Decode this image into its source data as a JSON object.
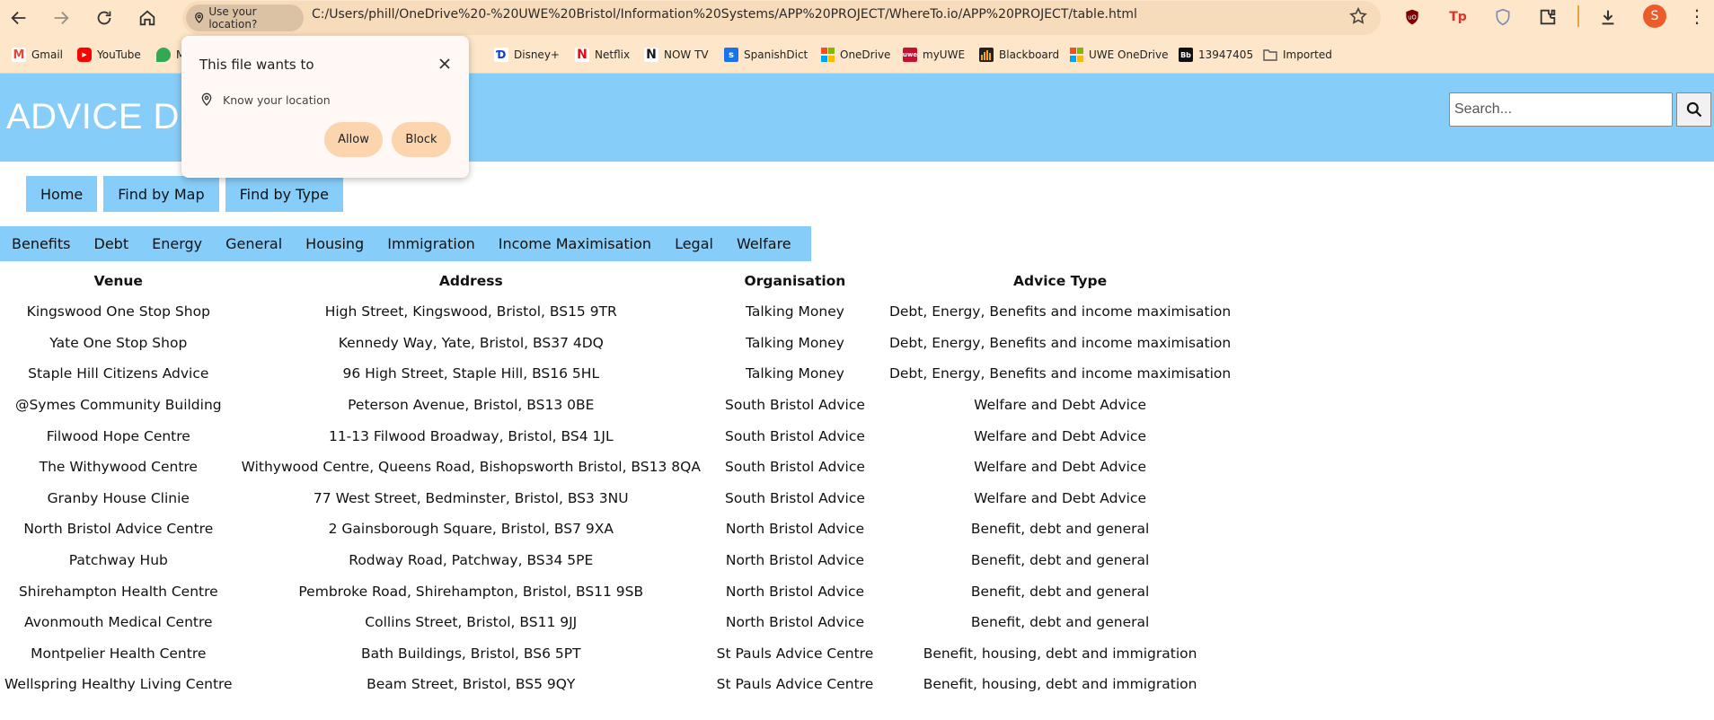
{
  "browser": {
    "location_chip": "Use your location?",
    "url": "C:/Users/phill/OneDrive%20-%20UWE%20Bristol/Information%20Systems/APP%20PROJECT/WhereTo.io/APP%20PROJECT/table.html",
    "profile_initial": "S",
    "extensions": [
      "uBlock Origin",
      "Tp",
      "shield",
      "puzzle"
    ],
    "bookmarks": [
      {
        "label": "Gmail",
        "icon": "gmail-icon",
        "color": "#ea4335"
      },
      {
        "label": "YouTube",
        "icon": "youtube-icon",
        "color": "#ff0000"
      },
      {
        "label": "M",
        "icon": "maps-icon",
        "color": "#34a853"
      },
      {
        "label": "Disney+",
        "icon": "disney-icon",
        "color": "#113ccf"
      },
      {
        "label": "Netflix",
        "icon": "netflix-icon",
        "color": "#e50914"
      },
      {
        "label": "NOW TV",
        "icon": "nowtv-icon",
        "color": "#1a1a1a"
      },
      {
        "label": "SpanishDict",
        "icon": "spanishdict-icon",
        "color": "#1a73e8"
      },
      {
        "label": "OneDrive",
        "icon": "microsoft-icon",
        "color": "#f25022"
      },
      {
        "label": "myUWE",
        "icon": "myuwe-icon",
        "color": "#c8102e"
      },
      {
        "label": "Blackboard",
        "icon": "blackboard-icon",
        "color": "#222222"
      },
      {
        "label": "UWE OneDrive",
        "icon": "microsoft-icon",
        "color": "#f25022"
      },
      {
        "label": "13947405",
        "icon": "bb-icon",
        "color": "#111111"
      },
      {
        "label": "Imported",
        "icon": "folder-icon",
        "color": "#555555"
      }
    ]
  },
  "popup": {
    "title": "This file wants to",
    "permission": "Know your location",
    "allow_label": "Allow",
    "block_label": "Block"
  },
  "site": {
    "title": "ADVICE DROP",
    "search_placeholder": "Search...",
    "nav": [
      "Home",
      "Find by Map",
      "Find by Type"
    ],
    "types": [
      "Benefits",
      "Debt",
      "Energy",
      "General",
      "Housing",
      "Immigration",
      "Income Maximisation",
      "Legal",
      "Welfare"
    ]
  },
  "table": {
    "headers": [
      "Venue",
      "Address",
      "Organisation",
      "Advice Type"
    ],
    "rows": [
      [
        "Kingswood One Stop Shop",
        "High Street, Kingswood, Bristol, BS15 9TR",
        "Talking Money",
        "Debt, Energy, Benefits and income maximisation"
      ],
      [
        "Yate One Stop Shop",
        "Kennedy Way, Yate, Bristol, BS37 4DQ",
        "Talking Money",
        "Debt, Energy, Benefits and income maximisation"
      ],
      [
        "Staple Hill Citizens Advice",
        "96 High Street, Staple Hill, BS16 5HL",
        "Talking Money",
        "Debt, Energy, Benefits and income maximisation"
      ],
      [
        "@Symes Community Building",
        "Peterson Avenue, Bristol, BS13 0BE",
        "South Bristol Advice",
        "Welfare and Debt Advice"
      ],
      [
        "Filwood Hope Centre",
        "11-13 Filwood Broadway, Bristol, BS4 1JL",
        "South Bristol Advice",
        "Welfare and Debt Advice"
      ],
      [
        "The Withywood Centre",
        "Withywood Centre, Queens Road, Bishopsworth Bristol, BS13 8QA",
        "South Bristol Advice",
        "Welfare and Debt Advice"
      ],
      [
        "Granby House Clinie",
        "77 West Street, Bedminster, Bristol, BS3 3NU",
        "South Bristol Advice",
        "Welfare and Debt Advice"
      ],
      [
        "North Bristol Advice Centre",
        "2 Gainsborough Square, Bristol, BS7 9XA",
        "North Bristol Advice",
        "Benefit, debt and general"
      ],
      [
        "Patchway Hub",
        "Rodway Road, Patchway, BS34 5PE",
        "North Bristol Advice",
        "Benefit, debt and general"
      ],
      [
        "Shirehampton Health Centre",
        "Pembroke Road, Shirehampton, Bristol, BS11 9SB",
        "North Bristol Advice",
        "Benefit, debt and general"
      ],
      [
        "Avonmouth Medical Centre",
        "Collins Street, Bristol, BS11 9JJ",
        "North Bristol Advice",
        "Benefit, debt and general"
      ],
      [
        "Montpelier Health Centre",
        "Bath Buildings, Bristol, BS6 5PT",
        "St Pauls Advice Centre",
        "Benefit, housing, debt and immigration"
      ],
      [
        "Wellspring Healthy Living Centre",
        "Beam Street, Bristol, BS5 9QY",
        "St Pauls Advice Centre",
        "Benefit, housing, debt and immigration"
      ]
    ]
  },
  "colors": {
    "browser_chrome": "#fde6c9",
    "header_blue": "#87cdf9",
    "popup_button": "#fcd4ae"
  }
}
